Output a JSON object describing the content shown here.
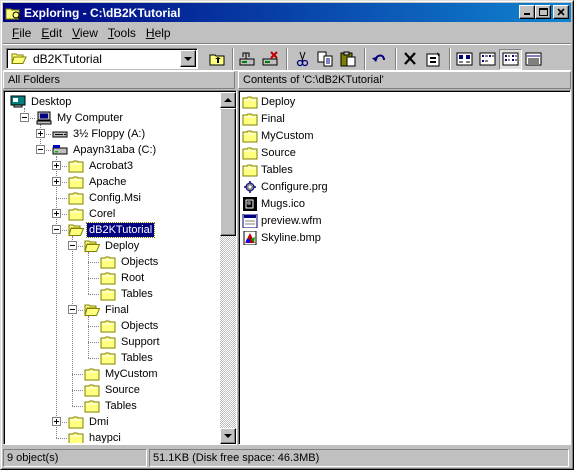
{
  "window": {
    "title": "Exploring - C:\\dB2KTutorial",
    "minimize_label": "Minimize",
    "maximize_label": "Maximize",
    "close_label": "Close"
  },
  "menu": [
    {
      "label": "File",
      "hotkey": "F",
      "rest": "ile"
    },
    {
      "label": "Edit",
      "hotkey": "E",
      "rest": "dit"
    },
    {
      "label": "View",
      "hotkey": "V",
      "rest": "iew"
    },
    {
      "label": "Tools",
      "hotkey": "T",
      "rest": "ools"
    },
    {
      "label": "Help",
      "hotkey": "H",
      "rest": "elp"
    }
  ],
  "toolbar": {
    "address_value": "dB2KTutorial",
    "buttons": [
      "up-one-level",
      "map-network-drive",
      "disconnect-network-drive",
      "cut",
      "copy",
      "paste",
      "undo",
      "delete",
      "properties",
      "large-icons",
      "small-icons",
      "list",
      "details"
    ]
  },
  "panes": {
    "left_header": "All Folders",
    "right_header": "Contents of 'C:\\dB2KTutorial'"
  },
  "tree": [
    {
      "label": "Desktop",
      "icon": "desktop-icon",
      "level": 0,
      "expander": "none"
    },
    {
      "label": "My Computer",
      "icon": "computer-icon",
      "level": 1,
      "expander": "minus"
    },
    {
      "label": "3½ Floppy (A:)",
      "icon": "floppy-icon",
      "level": 2,
      "expander": "plus"
    },
    {
      "label": "Apayn31aba (C:)",
      "icon": "harddrive-icon",
      "level": 2,
      "expander": "minus"
    },
    {
      "label": "Acrobat3",
      "icon": "folder-icon",
      "level": 3,
      "expander": "plus"
    },
    {
      "label": "Apache",
      "icon": "folder-icon",
      "level": 3,
      "expander": "plus"
    },
    {
      "label": "Config.Msi",
      "icon": "folder-icon",
      "level": 3,
      "expander": "none"
    },
    {
      "label": "Corel",
      "icon": "folder-icon",
      "level": 3,
      "expander": "plus"
    },
    {
      "label": "dB2KTutorial",
      "icon": "folder-open-icon",
      "level": 3,
      "expander": "minus",
      "selected": true
    },
    {
      "label": "Deploy",
      "icon": "folder-open-icon",
      "level": 4,
      "expander": "minus"
    },
    {
      "label": "Objects",
      "icon": "folder-icon",
      "level": 5,
      "expander": "none"
    },
    {
      "label": "Root",
      "icon": "folder-icon",
      "level": 5,
      "expander": "none"
    },
    {
      "label": "Tables",
      "icon": "folder-icon",
      "level": 5,
      "expander": "none"
    },
    {
      "label": "Final",
      "icon": "folder-open-icon",
      "level": 4,
      "expander": "minus"
    },
    {
      "label": "Objects",
      "icon": "folder-icon",
      "level": 5,
      "expander": "none"
    },
    {
      "label": "Support",
      "icon": "folder-icon",
      "level": 5,
      "expander": "none"
    },
    {
      "label": "Tables",
      "icon": "folder-icon",
      "level": 5,
      "expander": "none"
    },
    {
      "label": "MyCustom",
      "icon": "folder-icon",
      "level": 4,
      "expander": "none"
    },
    {
      "label": "Source",
      "icon": "folder-icon",
      "level": 4,
      "expander": "none"
    },
    {
      "label": "Tables",
      "icon": "folder-icon",
      "level": 4,
      "expander": "none"
    },
    {
      "label": "Dmi",
      "icon": "folder-icon",
      "level": 3,
      "expander": "plus"
    },
    {
      "label": "haypci",
      "icon": "folder-icon",
      "level": 3,
      "expander": "none"
    }
  ],
  "files": [
    {
      "label": "Deploy",
      "icon": "folder-icon"
    },
    {
      "label": "Final",
      "icon": "folder-icon"
    },
    {
      "label": "MyCustom",
      "icon": "folder-icon"
    },
    {
      "label": "Source",
      "icon": "folder-icon"
    },
    {
      "label": "Tables",
      "icon": "folder-icon"
    },
    {
      "label": "Configure.prg",
      "icon": "prg-file-icon"
    },
    {
      "label": "Mugs.ico",
      "icon": "ico-file-icon"
    },
    {
      "label": "preview.wfm",
      "icon": "wfm-file-icon"
    },
    {
      "label": "Skyline.bmp",
      "icon": "bmp-file-icon"
    }
  ],
  "status": {
    "count": "9 object(s)",
    "size": "51.1KB (Disk free space: 46.3MB)"
  },
  "colors": {
    "title_bar_start": "#000080",
    "title_bar_end": "#1084d0",
    "selection": "#000080",
    "folder_yellow": "#ffff80",
    "folder_outline": "#808000"
  }
}
